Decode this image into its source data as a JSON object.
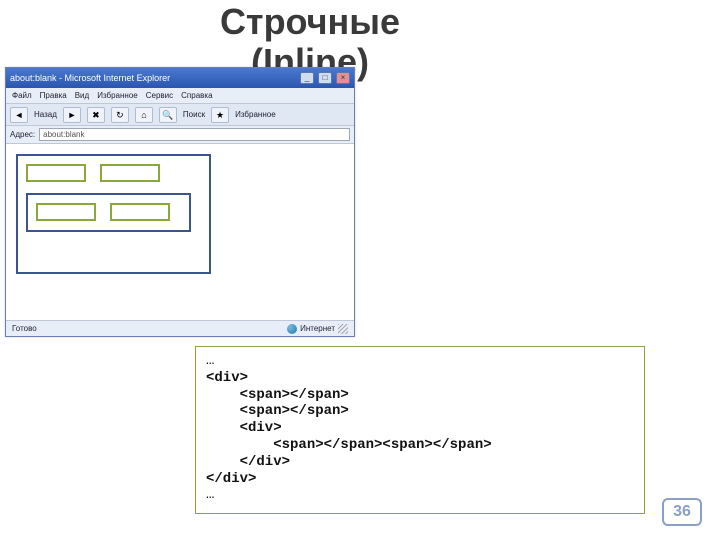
{
  "title": {
    "line1": "Строчные",
    "line2": "(Inline)"
  },
  "browser": {
    "window_title": "about:blank - Microsoft Internet Explorer",
    "menu": [
      "Файл",
      "Правка",
      "Вид",
      "Избранное",
      "Сервис",
      "Справка"
    ],
    "toolbar": {
      "back": "Назад",
      "search": "Поиск",
      "favorites": "Избранное"
    },
    "address_label": "Адрес:",
    "address_value": "about:blank",
    "status_left": "Готово",
    "status_zone": "Интернет"
  },
  "code": {
    "l0": "…",
    "l1": "<div>",
    "l2": "    <span></span>",
    "l3": "    <span></span>",
    "l4": "    <div>",
    "l5": "        <span></span><span></span>",
    "l6": "    </div>",
    "l7": "</div>",
    "l8": "…"
  },
  "page_number": "36"
}
